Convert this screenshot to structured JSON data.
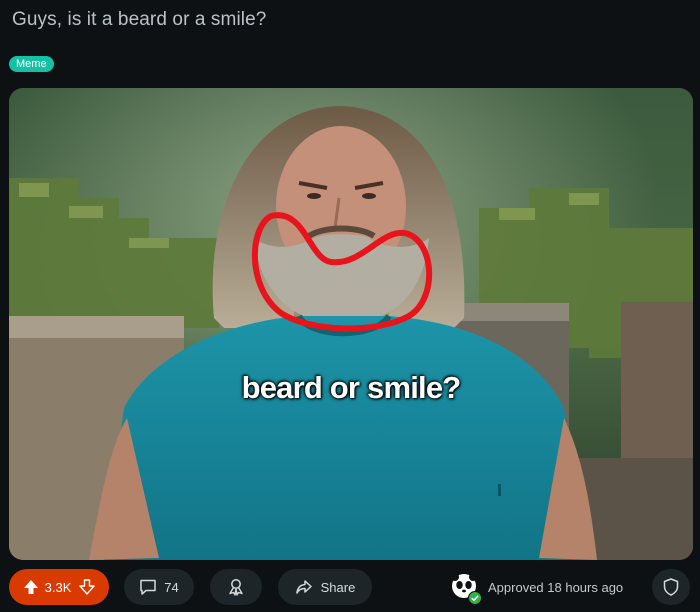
{
  "post": {
    "title": "Guys, is it a beard or a smile?",
    "flair": "Meme",
    "image_caption": "beard or smile?"
  },
  "actions": {
    "vote_count": "3.3K",
    "comment_count": "74",
    "share_label": "Share"
  },
  "moderation": {
    "status": "Approved 18 hours ago"
  },
  "colors": {
    "background": "#0e1113",
    "flair": "#16c0a5",
    "upvote_active": "#d93a00",
    "approved_check": "#2fb344"
  },
  "icons": [
    "upvote-icon",
    "downvote-icon",
    "comment-icon",
    "award-icon",
    "share-icon",
    "mod-shield-icon"
  ]
}
